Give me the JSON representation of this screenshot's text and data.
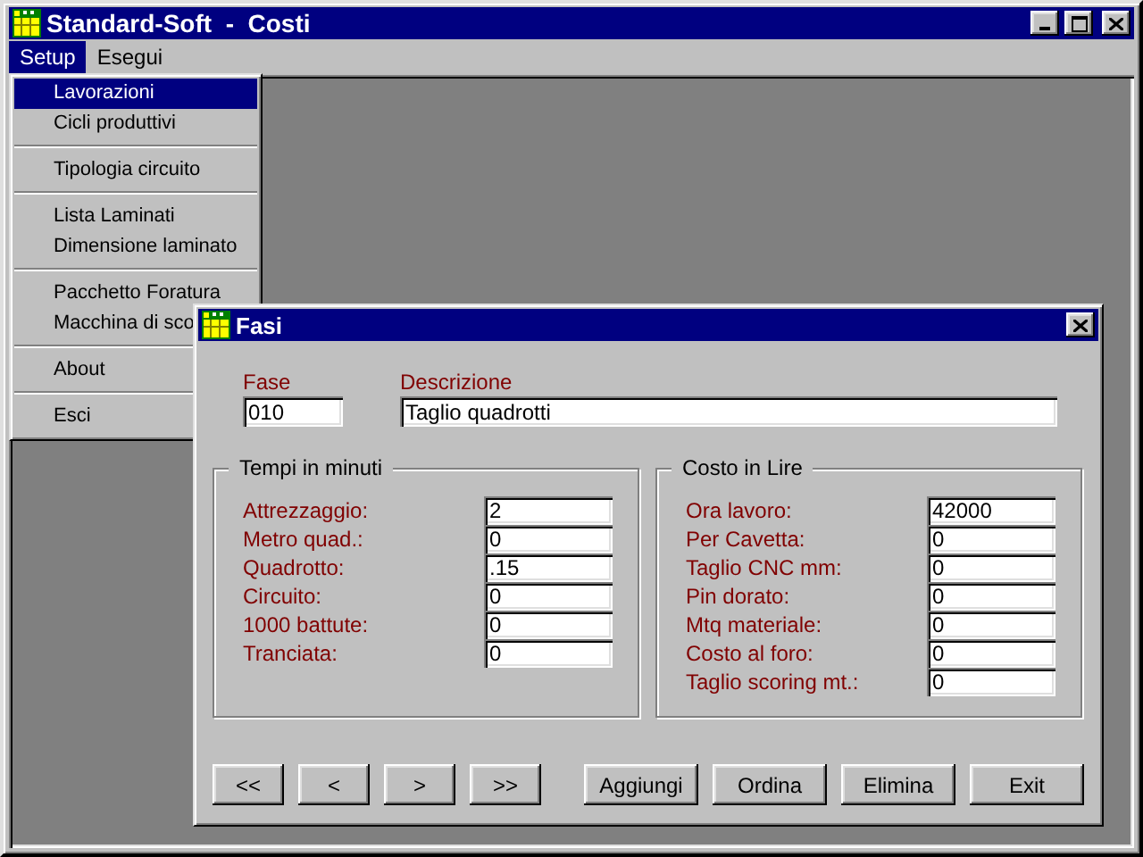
{
  "window": {
    "title": "Standard-Soft  -  Costi"
  },
  "menu_bar": [
    {
      "label": "Setup",
      "selected": true
    },
    {
      "label": "Esegui",
      "selected": false
    }
  ],
  "dropdown": {
    "sections": [
      {
        "items": [
          {
            "label": "Lavorazioni",
            "selected": true
          },
          {
            "label": "Cicli produttivi",
            "selected": false
          }
        ]
      },
      {
        "items": [
          {
            "label": "Tipologia circuito",
            "selected": false
          }
        ]
      },
      {
        "items": [
          {
            "label": "Lista Laminati",
            "selected": false
          },
          {
            "label": "Dimensione laminato",
            "selected": false
          }
        ]
      },
      {
        "items": [
          {
            "label": "Pacchetto Foratura",
            "selected": false
          },
          {
            "label": "Macchina di sco",
            "selected": false
          }
        ]
      },
      {
        "items": [
          {
            "label": "About",
            "selected": false
          }
        ]
      },
      {
        "items": [
          {
            "label": "Esci",
            "selected": false
          }
        ]
      }
    ]
  },
  "dialog": {
    "title": "Fasi",
    "fase": {
      "label": "Fase",
      "value": "010"
    },
    "descrizione": {
      "label": "Descrizione",
      "value": "Taglio quadrotti"
    },
    "groups": [
      {
        "title": "Tempi in minuti",
        "fields": [
          {
            "label": "Attrezzaggio:",
            "value": "2"
          },
          {
            "label": "Metro quad.:",
            "value": "0"
          },
          {
            "label": "Quadrotto:",
            "value": ".15"
          },
          {
            "label": "Circuito:",
            "value": "0"
          },
          {
            "label": "1000 battute:",
            "value": "0"
          },
          {
            "label": "Tranciata:",
            "value": "0"
          }
        ]
      },
      {
        "title": "Costo in Lire",
        "fields": [
          {
            "label": "Ora lavoro:",
            "value": "42000"
          },
          {
            "label": "Per Cavetta:",
            "value": "0"
          },
          {
            "label": "Taglio CNC mm:",
            "value": "0"
          },
          {
            "label": "Pin dorato:",
            "value": "0"
          },
          {
            "label": "Mtq materiale:",
            "value": "0"
          },
          {
            "label": "Costo al foro:",
            "value": "0"
          },
          {
            "label": "Taglio scoring mt.:",
            "value": "0"
          }
        ]
      }
    ],
    "nav_buttons": [
      "<<",
      "<",
      ">",
      ">>"
    ],
    "action_buttons": [
      "Aggiungi",
      "Ordina",
      "Elimina",
      "Exit"
    ]
  }
}
